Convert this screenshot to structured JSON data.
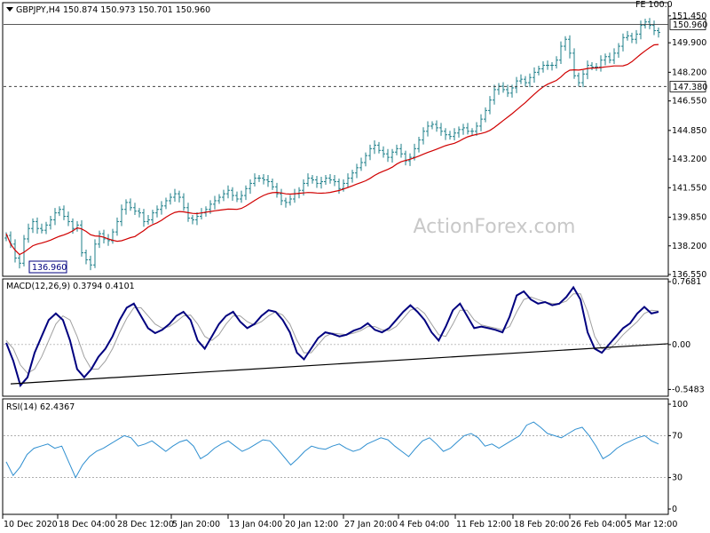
{
  "colors": {
    "price_bars": "#1e7f8a",
    "moving_average": "#d00000",
    "macd_main": "#00007f",
    "macd_signal": "#a0a0a0",
    "rsi_line": "#2f8fd0",
    "border": "#000000",
    "level_line": "#404040",
    "trendline": "#000000",
    "watermark": "#c8c8c8"
  },
  "watermark": "ActionForex.com",
  "icons": {
    "symbol_marker": "triangle-down-icon"
  },
  "chart_data": [
    {
      "type": "candlestick",
      "title": "GBPJPY,H4  150.874 150.973 150.701 150.960",
      "symbol": "GBPJPY",
      "timeframe": "H4",
      "ohlc_last": {
        "open": 150.874,
        "high": 150.973,
        "low": 150.701,
        "close": 150.96
      },
      "ylim": [
        136.55,
        151.75
      ],
      "yticks": [
        151.45,
        149.9,
        148.2,
        146.55,
        144.85,
        143.2,
        141.55,
        139.85,
        138.2,
        136.55
      ],
      "ytick_labels": [
        "151.450",
        "149.900",
        "148.200",
        "146.550",
        "144.850",
        "143.200",
        "141.550",
        "139.850",
        "138.200",
        "136.550"
      ],
      "price_labels": {
        "current": "150.960",
        "level": "147.380",
        "low_annotation": "136.960"
      },
      "horizontal_levels": [
        150.96,
        147.38
      ],
      "top_right_label": "FE 100.0",
      "close_series": [
        138.8,
        138.3,
        137.5,
        137.2,
        138.6,
        139.2,
        139.6,
        139.2,
        139.1,
        139.4,
        139.7,
        140.1,
        140.3,
        139.9,
        139.6,
        139.2,
        139.4,
        137.8,
        137.4,
        137.1,
        138.3,
        138.9,
        138.6,
        138.5,
        139.0,
        139.6,
        140.3,
        140.7,
        140.4,
        140.2,
        140.1,
        139.6,
        139.7,
        140.1,
        140.3,
        140.5,
        140.8,
        141.0,
        141.2,
        141.0,
        140.4,
        139.8,
        139.7,
        139.9,
        140.1,
        140.3,
        140.6,
        140.8,
        141.0,
        141.2,
        141.4,
        141.1,
        140.9,
        141.1,
        141.5,
        141.8,
        142.1,
        142.1,
        142.0,
        141.9,
        141.6,
        141.2,
        140.8,
        140.7,
        140.9,
        141.2,
        141.4,
        141.8,
        142.1,
        142.0,
        141.8,
        141.9,
        142.1,
        142.0,
        141.9,
        141.5,
        141.8,
        142.1,
        142.4,
        142.7,
        143.0,
        143.4,
        143.8,
        144.0,
        143.7,
        143.5,
        143.3,
        143.6,
        143.8,
        143.5,
        143.1,
        143.3,
        143.8,
        144.3,
        144.8,
        145.1,
        145.2,
        145.0,
        144.8,
        144.6,
        144.5,
        144.7,
        144.9,
        145.0,
        144.8,
        144.8,
        145.1,
        145.5,
        146.0,
        146.6,
        147.2,
        147.4,
        147.2,
        147.0,
        147.3,
        147.7,
        147.8,
        147.6,
        147.9,
        148.2,
        148.4,
        148.6,
        148.6,
        148.6,
        148.9,
        149.7,
        150.1,
        149.3,
        148.0,
        147.6,
        148.1,
        148.6,
        148.5,
        148.5,
        148.9,
        149.1,
        148.9,
        149.3,
        149.7,
        150.2,
        150.3,
        150.1,
        150.4,
        150.9,
        151.1,
        150.9,
        150.6,
        150.5
      ],
      "moving_average": {
        "start": 138.9,
        "end": 149.8
      },
      "xticks": [
        "10 Dec 2020",
        "18 Dec 04:00",
        "28 Dec 12:00",
        "5 Jan 20:00",
        "13 Jan 04:00",
        "20 Jan 12:00",
        "27 Jan 20:00",
        "4 Feb 04:00",
        "11 Feb 12:00",
        "18 Feb 20:00",
        "26 Feb 04:00",
        "5 Mar 12:00"
      ]
    },
    {
      "type": "line",
      "title": "MACD(12,26,9) 0.3794 0.4101",
      "macd_value": 0.3794,
      "signal_value": 0.4101,
      "ylim": [
        -0.62,
        0.78
      ],
      "yticks": [
        0.7681,
        0.0,
        -0.5483
      ],
      "ytick_labels": [
        "0.7681",
        "0.00",
        "-0.5483"
      ],
      "macd_series": [
        0.02,
        -0.2,
        -0.5,
        -0.4,
        -0.1,
        0.1,
        0.3,
        0.38,
        0.3,
        0.05,
        -0.3,
        -0.4,
        -0.3,
        -0.15,
        -0.05,
        0.1,
        0.3,
        0.45,
        0.5,
        0.35,
        0.2,
        0.14,
        0.18,
        0.25,
        0.35,
        0.4,
        0.3,
        0.05,
        -0.05,
        0.1,
        0.25,
        0.35,
        0.4,
        0.28,
        0.2,
        0.25,
        0.35,
        0.42,
        0.4,
        0.3,
        0.15,
        -0.1,
        -0.18,
        -0.05,
        0.08,
        0.15,
        0.13,
        0.1,
        0.12,
        0.17,
        0.2,
        0.26,
        0.18,
        0.15,
        0.2,
        0.3,
        0.4,
        0.48,
        0.4,
        0.3,
        0.15,
        0.05,
        0.22,
        0.42,
        0.5,
        0.35,
        0.2,
        0.22,
        0.2,
        0.18,
        0.15,
        0.34,
        0.6,
        0.65,
        0.55,
        0.5,
        0.52,
        0.48,
        0.5,
        0.58,
        0.7,
        0.55,
        0.15,
        -0.05,
        -0.1,
        0.0,
        0.1,
        0.2,
        0.26,
        0.38,
        0.46,
        0.38,
        0.4
      ],
      "signal_series": [
        0.05,
        -0.05,
        -0.25,
        -0.35,
        -0.3,
        -0.15,
        0.05,
        0.25,
        0.35,
        0.3,
        0.1,
        -0.15,
        -0.3,
        -0.3,
        -0.2,
        -0.05,
        0.15,
        0.32,
        0.45,
        0.45,
        0.35,
        0.25,
        0.2,
        0.22,
        0.28,
        0.35,
        0.36,
        0.25,
        0.1,
        0.05,
        0.12,
        0.25,
        0.35,
        0.35,
        0.28,
        0.24,
        0.28,
        0.35,
        0.4,
        0.36,
        0.25,
        0.05,
        -0.1,
        -0.1,
        0.0,
        0.1,
        0.14,
        0.13,
        0.12,
        0.14,
        0.17,
        0.22,
        0.22,
        0.18,
        0.17,
        0.22,
        0.32,
        0.42,
        0.45,
        0.38,
        0.25,
        0.12,
        0.1,
        0.25,
        0.42,
        0.42,
        0.3,
        0.24,
        0.22,
        0.2,
        0.18,
        0.22,
        0.4,
        0.55,
        0.58,
        0.55,
        0.52,
        0.5,
        0.5,
        0.53,
        0.62,
        0.62,
        0.4,
        0.1,
        -0.05,
        -0.06,
        0.02,
        0.12,
        0.2,
        0.28,
        0.38,
        0.42,
        0.41
      ],
      "trendline": {
        "start": -0.48,
        "end": 0.01
      }
    },
    {
      "type": "line",
      "title": "RSI(14) 62.4367",
      "rsi_value": 62.4367,
      "ylim": [
        0,
        100
      ],
      "yticks": [
        100,
        70,
        30,
        0
      ],
      "ytick_labels": [
        "100",
        "70",
        "30",
        "0"
      ],
      "levels": [
        70,
        30
      ],
      "rsi_series": [
        45,
        32,
        40,
        52,
        58,
        60,
        62,
        58,
        60,
        45,
        30,
        42,
        50,
        55,
        58,
        62,
        66,
        70,
        68,
        60,
        62,
        65,
        60,
        55,
        60,
        64,
        66,
        60,
        48,
        52,
        58,
        62,
        65,
        60,
        55,
        58,
        62,
        66,
        65,
        58,
        50,
        42,
        48,
        55,
        60,
        58,
        57,
        60,
        62,
        58,
        55,
        57,
        62,
        65,
        68,
        66,
        60,
        55,
        50,
        58,
        65,
        68,
        62,
        55,
        58,
        64,
        70,
        72,
        68,
        60,
        62,
        58,
        62,
        66,
        70,
        80,
        83,
        78,
        72,
        70,
        68,
        72,
        76,
        78,
        70,
        60,
        48,
        52,
        58,
        62,
        65,
        68,
        70,
        65,
        62
      ]
    }
  ]
}
